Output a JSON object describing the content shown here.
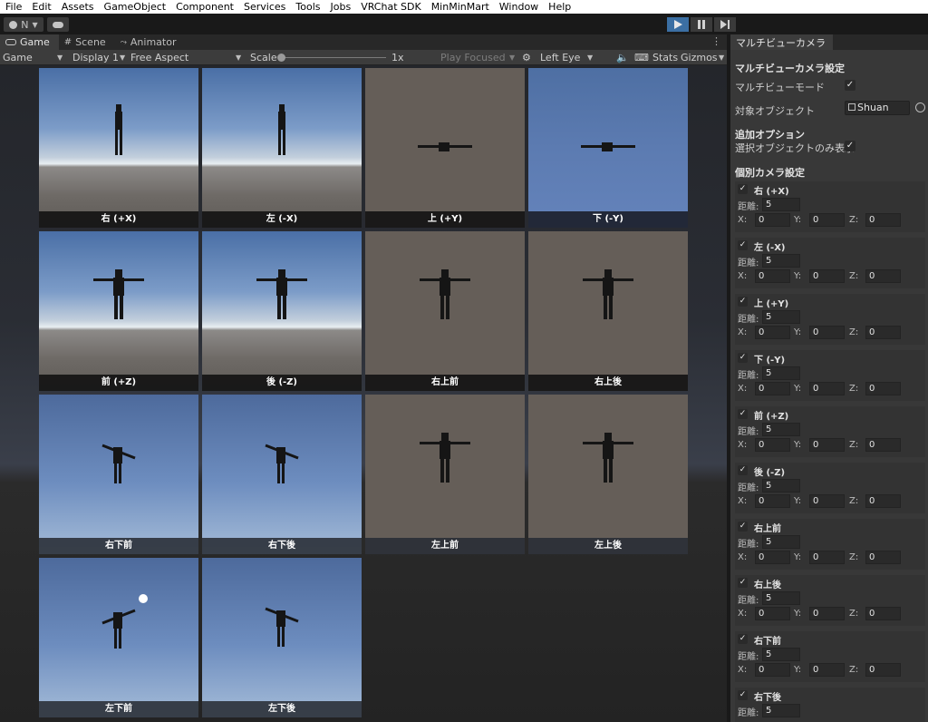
{
  "menu": [
    "File",
    "Edit",
    "Assets",
    "GameObject",
    "Component",
    "Services",
    "Tools",
    "Jobs",
    "VRChat SDK",
    "MinMinMart",
    "Window",
    "Help"
  ],
  "toolbar": {
    "account_label": "N"
  },
  "tabs": {
    "game": "Game",
    "scene": "Scene",
    "animator": "Animator"
  },
  "gamebar": {
    "mode": "Game",
    "display": "Display 1",
    "aspect": "Free Aspect",
    "scale_label": "Scale",
    "scale_value": "1x",
    "play_focused": "Play Focused",
    "eye": "Left Eye",
    "stats": "Stats",
    "gizmos": "Gizmos"
  },
  "views": [
    {
      "label": "右 (+X)"
    },
    {
      "label": "左 (-X)"
    },
    {
      "label": "上 (+Y)"
    },
    {
      "label": "下 (-Y)"
    },
    {
      "label": "前 (+Z)"
    },
    {
      "label": "後 (-Z)"
    },
    {
      "label": "右上前"
    },
    {
      "label": "右上後"
    },
    {
      "label": "右下前"
    },
    {
      "label": "右下後"
    },
    {
      "label": "左上前"
    },
    {
      "label": "左上後"
    },
    {
      "label": "左下前"
    },
    {
      "label": "左下後"
    }
  ],
  "panel": {
    "tab": "マルチビューカメラ",
    "section_title": "マルチビューカメラ設定",
    "multiview_mode_label": "マルチビューモード",
    "multiview_mode_checked": true,
    "target_object_label": "対象オブジェクト",
    "target_object_value": "Shuan",
    "additional_options_title": "追加オプション",
    "selected_only_label": "選択オブジェクトのみ表示",
    "selected_only_checked": true,
    "individual_title": "個別カメラ設定",
    "distance_label": "距離:",
    "x_label": "X:",
    "y_label": "Y:",
    "z_label": "Z:",
    "cameras": [
      {
        "name": "右 (+X)",
        "enabled": true,
        "distance": "5",
        "x": "0",
        "y": "0",
        "z": "0"
      },
      {
        "name": "左 (-X)",
        "enabled": true,
        "distance": "5",
        "x": "0",
        "y": "0",
        "z": "0"
      },
      {
        "name": "上 (+Y)",
        "enabled": true,
        "distance": "5",
        "x": "0",
        "y": "0",
        "z": "0"
      },
      {
        "name": "下 (-Y)",
        "enabled": true,
        "distance": "5",
        "x": "0",
        "y": "0",
        "z": "0"
      },
      {
        "name": "前 (+Z)",
        "enabled": true,
        "distance": "5",
        "x": "0",
        "y": "0",
        "z": "0"
      },
      {
        "name": "後 (-Z)",
        "enabled": true,
        "distance": "5",
        "x": "0",
        "y": "0",
        "z": "0"
      },
      {
        "name": "右上前",
        "enabled": true,
        "distance": "5",
        "x": "0",
        "y": "0",
        "z": "0"
      },
      {
        "name": "右上後",
        "enabled": true,
        "distance": "5",
        "x": "0",
        "y": "0",
        "z": "0"
      },
      {
        "name": "右下前",
        "enabled": true,
        "distance": "5",
        "x": "0",
        "y": "0",
        "z": "0"
      },
      {
        "name": "右下後",
        "enabled": true,
        "distance": "5"
      }
    ]
  }
}
